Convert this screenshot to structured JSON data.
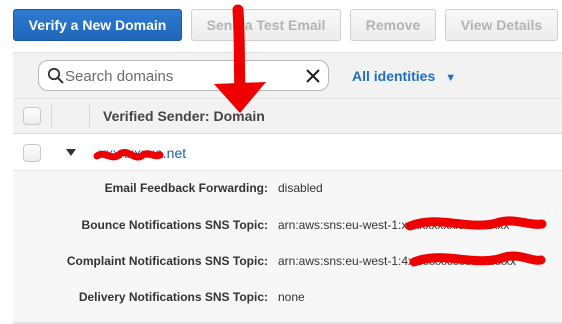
{
  "toolbar": {
    "verify_label": "Verify a New Domain",
    "send_test_label": "Send a Test Email",
    "remove_label": "Remove",
    "view_details_label": "View Details"
  },
  "search": {
    "placeholder": "Search domains",
    "filter_label": "All identities"
  },
  "table": {
    "header": "Verified Sender: Domain",
    "rows": [
      {
        "domain": "xxxxxxxxa.net",
        "details": [
          {
            "label": "Email Feedback Forwarding:",
            "value": "disabled"
          },
          {
            "label": "Bounce Notifications SNS Topic:",
            "value": "arn:aws:sns:eu-west-1:xxxxxxxxxxxxxxxxxx"
          },
          {
            "label": "Complaint Notifications SNS Topic:",
            "value": "arn:aws:sns:eu-west-1:4xxxxxxxxxxxxxxxxxx"
          },
          {
            "label": "Delivery Notifications SNS Topic:",
            "value": "none"
          }
        ]
      }
    ]
  },
  "annotations": {
    "arrow_color": "#ee0000",
    "redaction_color": "#ee0000"
  }
}
